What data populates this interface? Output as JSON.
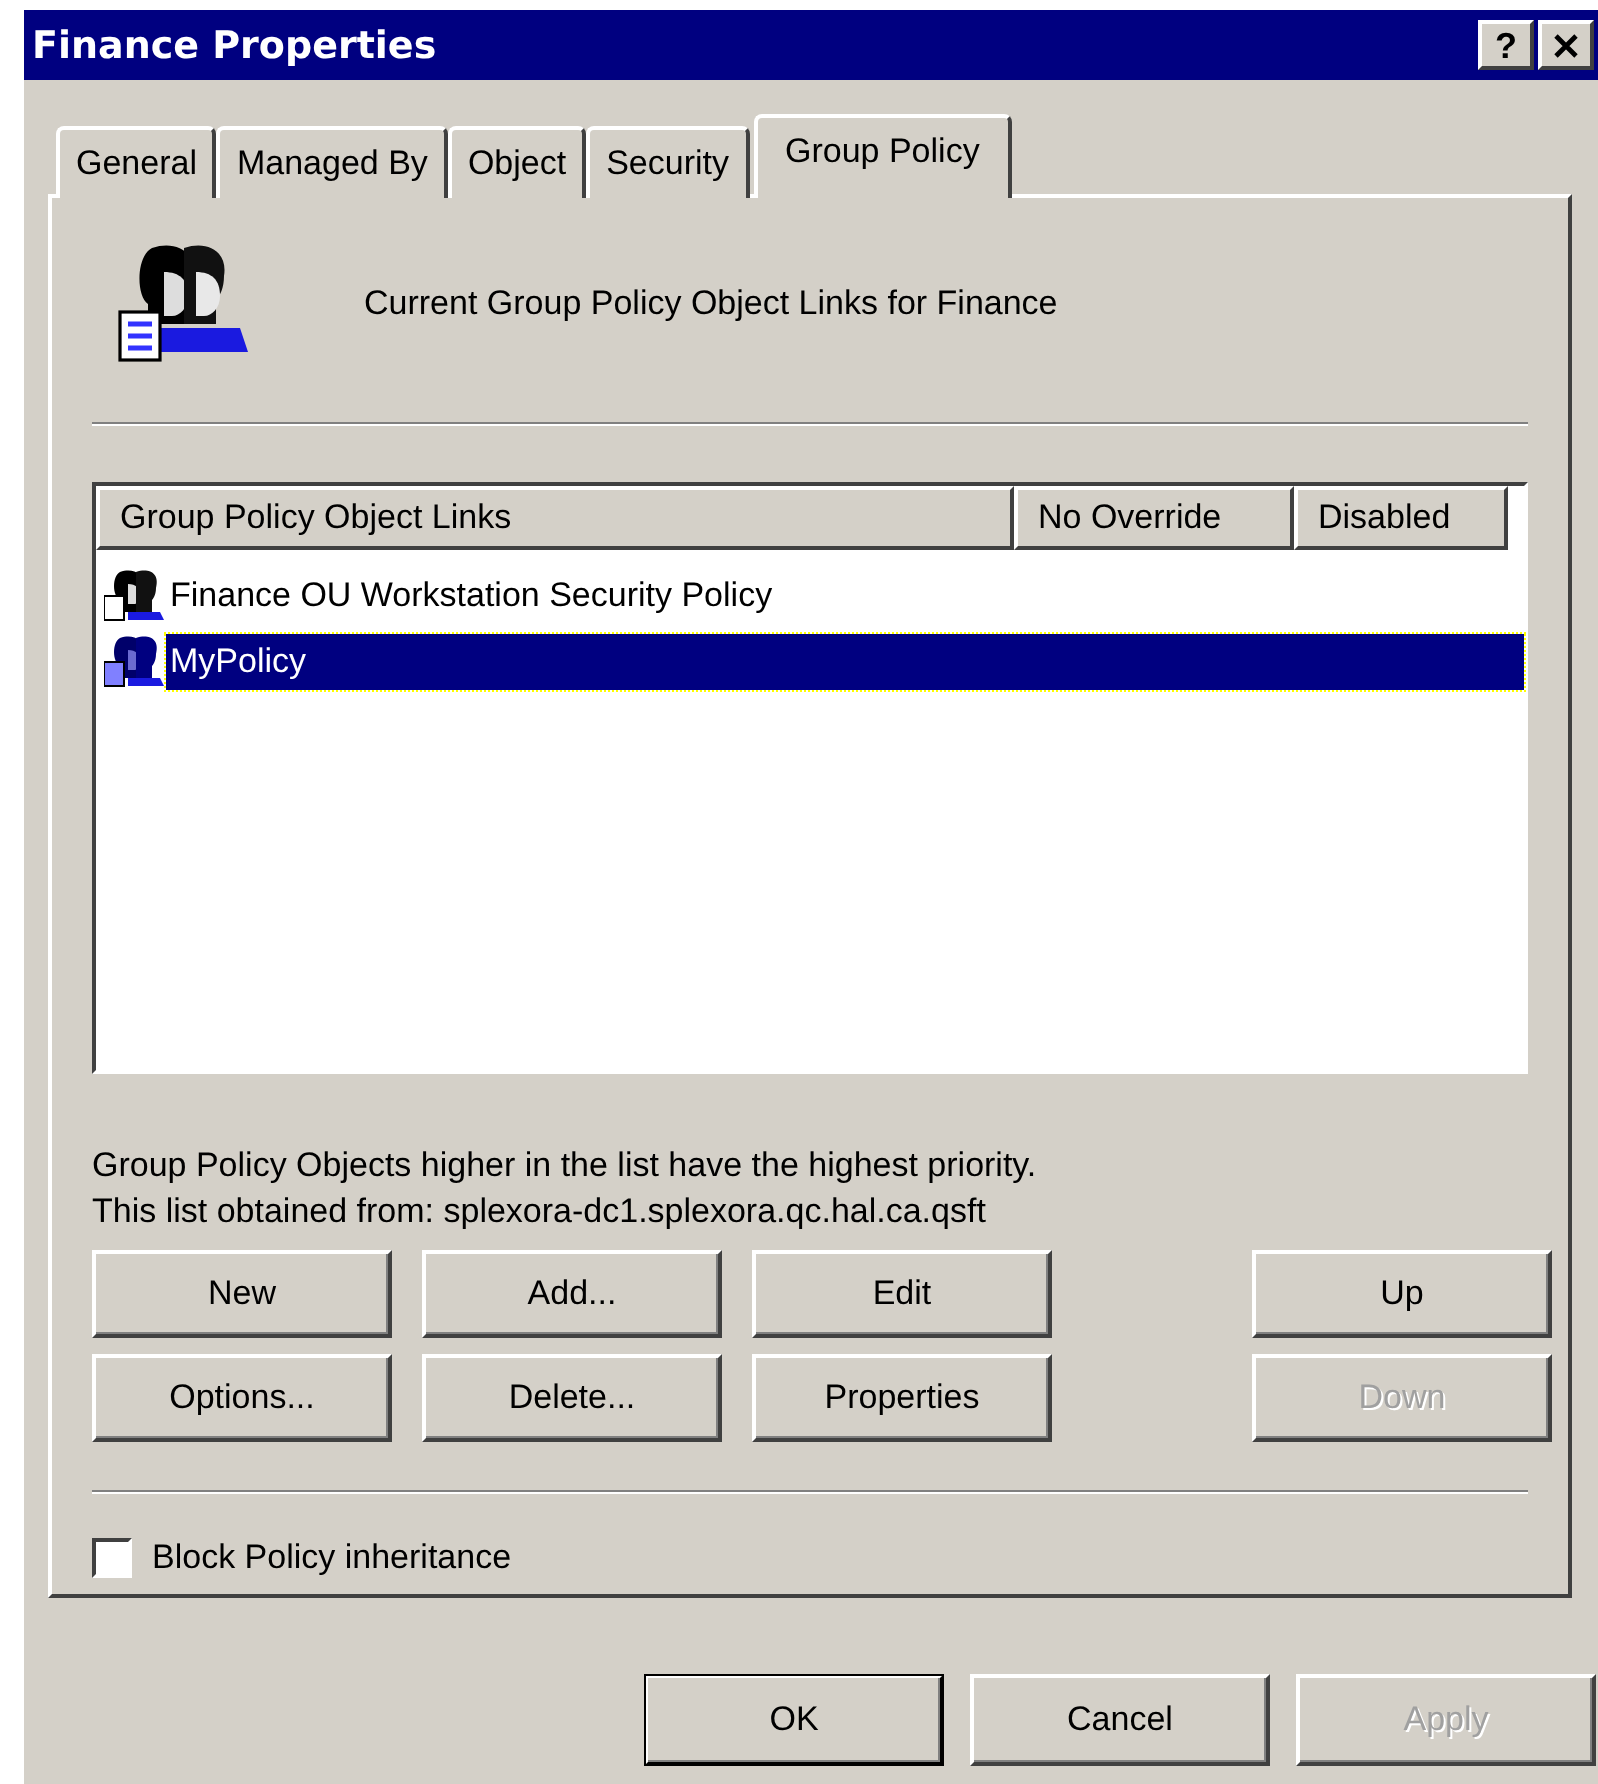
{
  "window": {
    "title": "Finance Properties",
    "title_buttons": [
      {
        "kind": "help",
        "label": "?"
      },
      {
        "kind": "close"
      }
    ]
  },
  "tabs": [
    {
      "label": "General",
      "selected": false
    },
    {
      "label": "Managed By",
      "selected": false
    },
    {
      "label": "Object",
      "selected": false
    },
    {
      "label": "Security",
      "selected": false
    },
    {
      "label": "Group Policy",
      "selected": true
    }
  ],
  "header": "Current Group Policy Object Links for Finance",
  "links_list": {
    "columns": [
      "Group Policy Object Links",
      "No Override",
      "Disabled"
    ],
    "rows": [
      {
        "name": "Finance OU Workstation Security Policy",
        "selected": false
      },
      {
        "name": "MyPolicy",
        "selected": true
      }
    ]
  },
  "notes": [
    "Group Policy Objects higher in the list have the highest priority.",
    "This list obtained from: splexora-dc1.splexora.qc.hal.ca.qsft"
  ],
  "buttons": [
    {
      "label": "New",
      "disabled": false
    },
    {
      "label": "Add...",
      "disabled": false
    },
    {
      "label": "Edit",
      "disabled": false
    },
    {
      "label": "Up",
      "disabled": false
    },
    {
      "label": "Options...",
      "disabled": false
    },
    {
      "label": "Delete...",
      "disabled": false
    },
    {
      "label": "Properties",
      "disabled": false
    },
    {
      "label": "Down",
      "disabled": true
    }
  ],
  "block_inheritance": {
    "label": "Block Policy inheritance",
    "checked": false
  },
  "dialog_buttons": [
    {
      "label": "OK",
      "disabled": false,
      "default": true
    },
    {
      "label": "Cancel",
      "disabled": false,
      "default": false
    },
    {
      "label": "Apply",
      "disabled": true,
      "default": false
    }
  ]
}
